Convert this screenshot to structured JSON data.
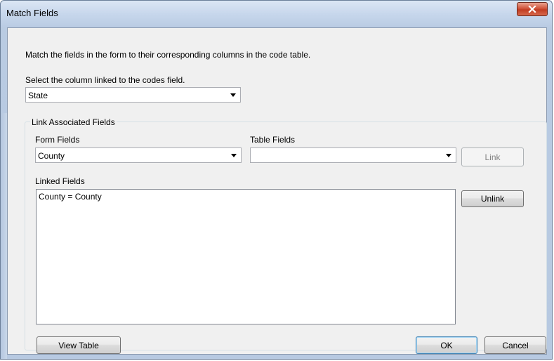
{
  "window": {
    "title": "Match Fields"
  },
  "instructions": "Match the fields in the form to their corresponding columns in the code table.",
  "codes_column": {
    "label": "Select the column linked to the codes field.",
    "value": "State"
  },
  "link_group": {
    "legend": "Link Associated Fields",
    "form_fields_label": "Form Fields",
    "form_fields_value": "County",
    "table_fields_label": "Table Fields",
    "table_fields_value": "",
    "link_button": "Link",
    "linked_fields_label": "Linked Fields",
    "linked_fields": [
      "County = County"
    ],
    "unlink_button": "Unlink"
  },
  "footer": {
    "view_table_button": "View Table",
    "ok_button": "OK",
    "cancel_button": "Cancel"
  },
  "icons": {
    "close": "close-icon",
    "dropdown": "chevron-down-icon"
  },
  "colors": {
    "close_button": "#c94a2f",
    "title_bar": "#c7d7ec",
    "client": "#f0f0f0"
  }
}
